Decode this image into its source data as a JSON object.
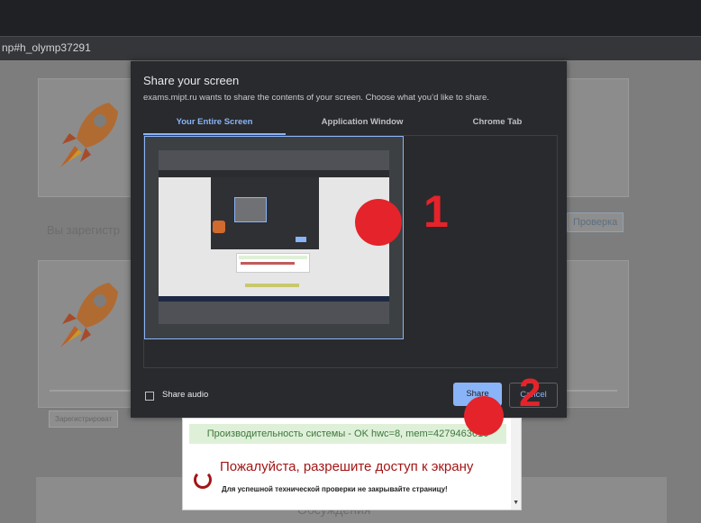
{
  "browser": {
    "url_fragment": "np#h_olymp37291"
  },
  "background_page": {
    "registered_text": "Вы зарегистр",
    "check_button": "Проверка",
    "register_field": "Зарегистрироват",
    "bottom_text": "Обсуждения"
  },
  "share_dialog": {
    "title": "Share your screen",
    "subtitle": "exams.mipt.ru wants to share the contents of your screen. Choose what you’d like to share.",
    "tabs": [
      {
        "label": "Your Entire Screen",
        "active": true
      },
      {
        "label": "Application Window",
        "active": false
      },
      {
        "label": "Chrome Tab",
        "active": false
      }
    ],
    "share_audio_label": "Share audio",
    "share_audio_checked": false,
    "share_button": "Share",
    "cancel_button": "Cancel"
  },
  "status_popup": {
    "performance": "Производительность системы - OK hwc=8, mem=4279463616",
    "error_message": "Пожалуйста, разрешите доступ к экрану",
    "note": "Для успешной технической проверки не закрывайте страницу!"
  },
  "annotations": {
    "marker1_label": "1",
    "marker2_label": "2",
    "color": "#e5232a"
  },
  "colors": {
    "accent": "#8ab4f8",
    "dialog_bg": "#292a2d",
    "error": "#a31515",
    "success_bg": "#dff0d8"
  }
}
